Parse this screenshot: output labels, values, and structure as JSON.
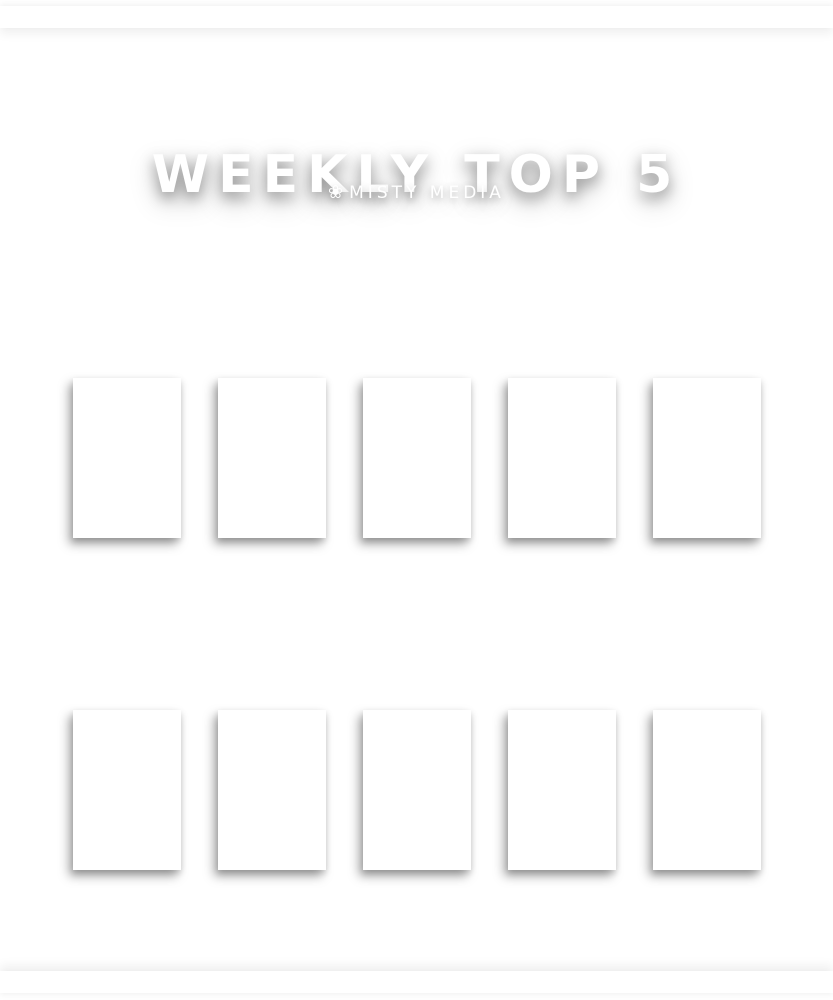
{
  "header": {
    "title": "WEEKLY TOP 5",
    "brand_icon": "lotus-icon",
    "brand_icon_glyph": "❀",
    "brand_name": "MISTY MEDIA"
  },
  "colors": {
    "background": "#ffffff",
    "text": "#ffffff"
  },
  "rows": [
    {
      "label": "",
      "slots": 5
    },
    {
      "label": "",
      "slots": 5
    }
  ]
}
